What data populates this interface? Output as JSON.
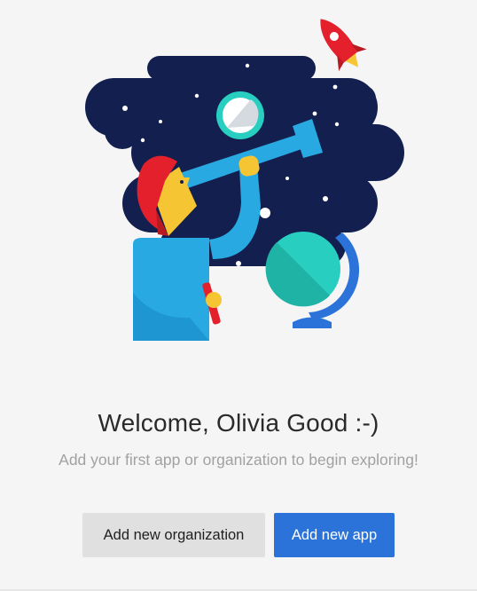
{
  "welcome": {
    "title": "Welcome, Olivia Good :-)",
    "subtitle": "Add your first app or organization to begin exploring!"
  },
  "actions": {
    "add_organization_label": "Add new organization",
    "add_app_label": "Add new app"
  },
  "illustration": {
    "icon": "astronomer-with-telescope-illustration",
    "colors": {
      "space": "#13204f",
      "telescope": "#29a9e1",
      "hair": "#e3202b",
      "skin": "#f6c533",
      "globe": "#28cfc0",
      "globe_stand": "#2b73d9",
      "rocket": "#e3202b"
    }
  },
  "theme": {
    "primary": "#2b73d9",
    "secondary_button": "#e0e0e0",
    "background": "#f5f5f6"
  }
}
